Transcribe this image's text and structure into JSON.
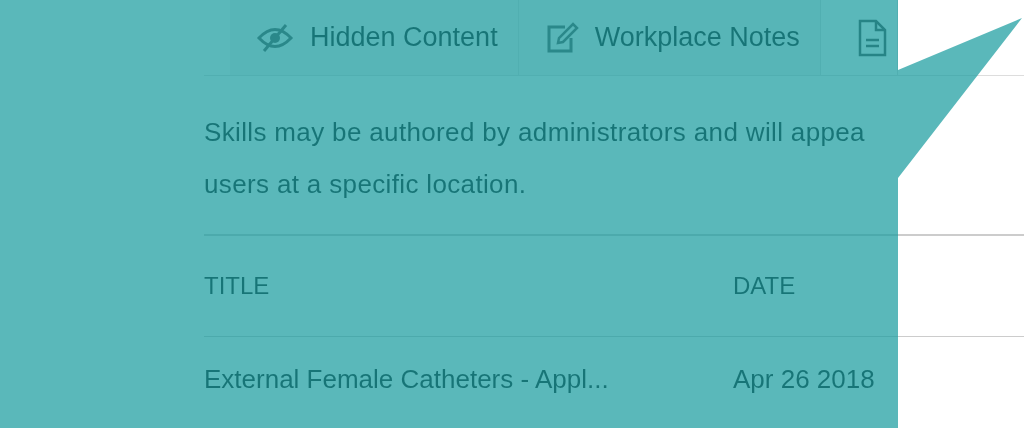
{
  "tabs": [
    {
      "label": "Hidden Content",
      "selected": false
    },
    {
      "label": "Workplace Notes",
      "selected": false
    },
    {
      "selected": true
    }
  ],
  "description": "Skills may be authored by administrators and will appea\nusers at a specific location.",
  "table": {
    "columns": [
      "TITLE",
      "DATE"
    ],
    "rows": [
      [
        "External Female Catheters - Appl...",
        "Apr 26 2018"
      ]
    ]
  }
}
